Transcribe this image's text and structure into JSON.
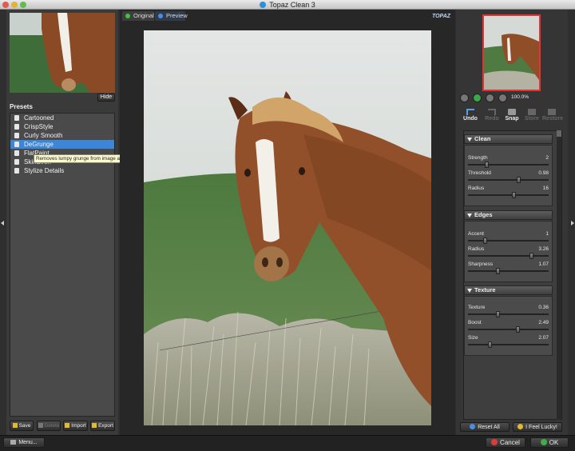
{
  "window": {
    "title": "Topaz Clean 3"
  },
  "left": {
    "hide_label": "Hide",
    "presets_title": "Presets",
    "presets": [
      "Cartooned",
      "CrispStyle",
      "Curly Smooth",
      "DeGrunge",
      "FlatPaint",
      "SkinEven",
      "Stylize Details"
    ],
    "selected_index": 3,
    "tooltip": "Removes lumpy grunge from image and preserves small detail and large texture.",
    "buttons": {
      "save": "Save",
      "delete": "Delete",
      "import": "Import",
      "export": "Export"
    }
  },
  "main": {
    "tabs": [
      {
        "label": "Original",
        "dot_color": "#3ec43e"
      },
      {
        "label": "Preview",
        "dot_color": "#4a8fe0"
      }
    ],
    "logo_text": "TOPAZ"
  },
  "right": {
    "zoom_label": "100.0%",
    "tools": {
      "undo": "Undo",
      "redo": "Redo",
      "snap": "Snap",
      "store": "Store",
      "restore": "Restore"
    },
    "sections": [
      {
        "name": "Clean",
        "sliders": [
          {
            "label": "Strength",
            "value": "2",
            "fraction": 0.22
          },
          {
            "label": "Threshold",
            "value": "0.98",
            "fraction": 0.64
          },
          {
            "label": "Radius",
            "value": "16",
            "fraction": 0.57
          }
        ]
      },
      {
        "name": "Edges",
        "sliders": [
          {
            "label": "Accent",
            "value": "1",
            "fraction": 0.2
          },
          {
            "label": "Radius",
            "value": "3.26",
            "fraction": 0.8
          },
          {
            "label": "Sharpness",
            "value": "1.07",
            "fraction": 0.36
          }
        ]
      },
      {
        "name": "Texture",
        "sliders": [
          {
            "label": "Texture",
            "value": "0.36",
            "fraction": 0.36
          },
          {
            "label": "Boost",
            "value": "2.49",
            "fraction": 0.62
          },
          {
            "label": "Size",
            "value": "2.07",
            "fraction": 0.26
          }
        ]
      }
    ],
    "reset_label": "Reset All",
    "lucky_label": "I Feel Lucky!"
  },
  "footer": {
    "menu_label": "Menu...",
    "cancel_label": "Cancel",
    "ok_label": "OK"
  },
  "colors": {
    "selected": "#3b86d8",
    "tooltip_bg": "#fdfbd2",
    "nav_frame": "#e23434"
  }
}
